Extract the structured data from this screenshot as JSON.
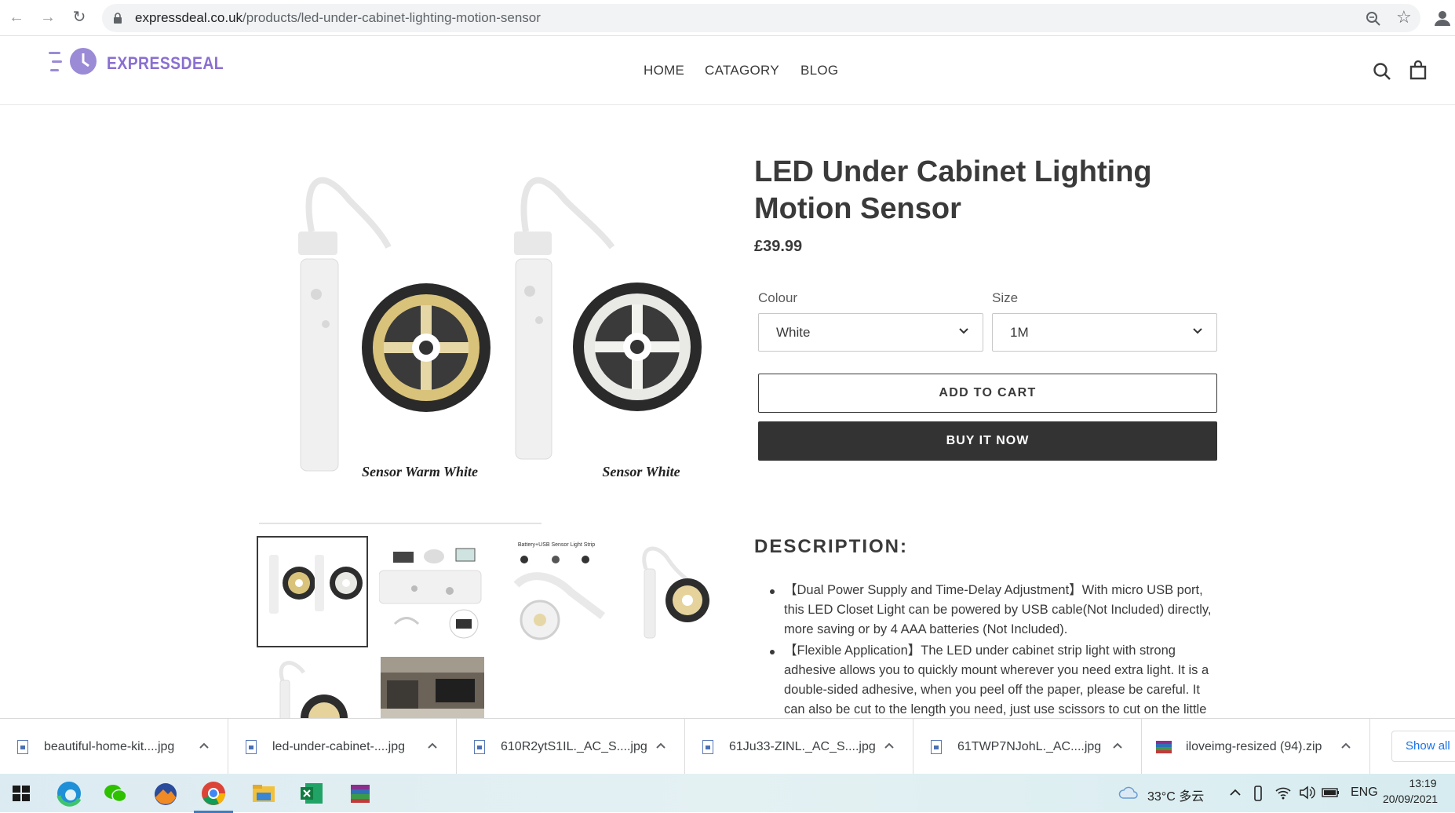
{
  "browser": {
    "url_domain": "expressdeal.co.uk",
    "url_path": "/products/led-under-cabinet-lighting-motion-sensor"
  },
  "site": {
    "logo_text": "EXPRESSDEAL",
    "nav": [
      "HOME",
      "CATAGORY",
      "BLOG"
    ],
    "brand_color": "#8a6fd1"
  },
  "product": {
    "title": "LED Under Cabinet Lighting Motion Sensor",
    "price": "£39.99",
    "colour_label": "Colour",
    "colour_value": "White",
    "size_label": "Size",
    "size_value": "1M",
    "add_to_cart": "ADD TO CART",
    "buy_now": "BUY IT NOW",
    "image_captions": [
      "Sensor Warm White",
      "Sensor White"
    ],
    "thumb3_caption": "Battery+USB Sensor Light Strip"
  },
  "description": {
    "heading": "DESCRIPTION:",
    "items": [
      "【Dual Power Supply and Time-Delay Adjustment】With micro USB port, this LED Closet Light can be powered by USB cable(Not Included) directly, more saving or by 4 AAA batteries (Not Included).",
      "【Flexible Application】The LED under cabinet strip light with strong adhesive allows you to quickly mount wherever you need extra light. It is a double-sided adhesive, when you peel off the paper, please be careful. It can also be cut to the length you need, just use scissors to cut on the little"
    ]
  },
  "downloads": {
    "items": [
      "beautiful-home-kit....jpg",
      "led-under-cabinet-....jpg",
      "610R2ytS1IL._AC_S....jpg",
      "61Ju33-ZINL._AC_S....jpg",
      "61TWP7NJohL._AC....jpg",
      "iloveimg-resized (94).zip"
    ],
    "show_all": "Show all"
  },
  "taskbar": {
    "weather": "33°C 多云",
    "lang": "ENG",
    "time": "13:19",
    "date": "20/09/2021"
  }
}
